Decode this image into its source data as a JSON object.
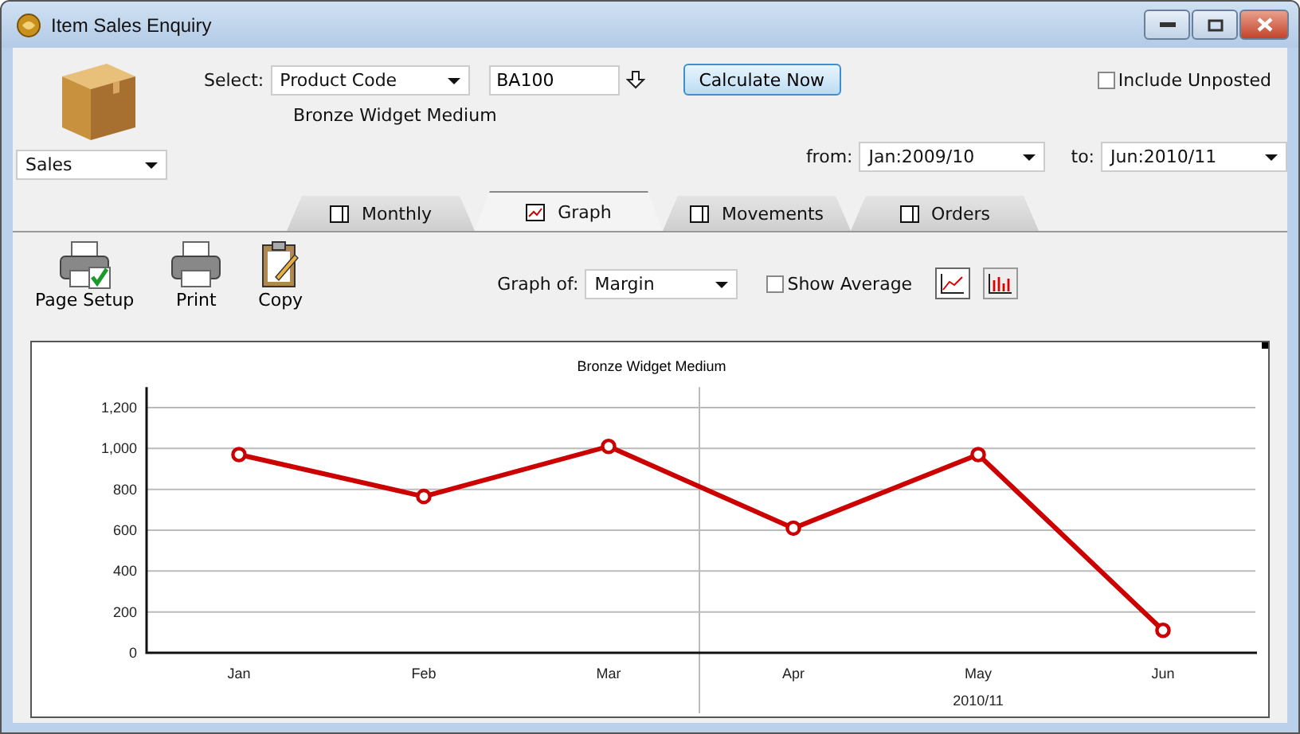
{
  "window": {
    "title": "Item Sales Enquiry"
  },
  "header": {
    "select_label": "Select:",
    "select_value": "Product Code",
    "code_value": "BA100",
    "calculate_button": "Calculate Now",
    "include_unposted": {
      "label": "Include Unposted",
      "checked": false
    },
    "product_name": "Bronze Widget Medium",
    "mode_value": "Sales",
    "from_label": "from:",
    "from_value": "Jan:2009/10",
    "to_label": "to:",
    "to_value": "Jun:2010/11"
  },
  "tabs": [
    {
      "label": "Monthly",
      "selected": false
    },
    {
      "label": "Graph",
      "selected": true
    },
    {
      "label": "Movements",
      "selected": false
    },
    {
      "label": "Orders",
      "selected": false
    }
  ],
  "toolbar": {
    "buttons": [
      {
        "label": "Page Setup",
        "kind": "setup"
      },
      {
        "label": "Print",
        "kind": "print"
      },
      {
        "label": "Copy",
        "kind": "copy"
      }
    ],
    "graph_of_label": "Graph of:",
    "graph_of_value": "Margin",
    "show_average": {
      "label": "Show Average",
      "checked": false
    },
    "chart_types": [
      {
        "kind": "line",
        "selected": true
      },
      {
        "kind": "bar",
        "selected": false
      }
    ]
  },
  "chart": {
    "chart_data": {
      "type": "line",
      "title": "Bronze Widget Medium",
      "categories": [
        "Jan",
        "Feb",
        "Mar",
        "Apr",
        "May",
        "Jun"
      ],
      "series": [
        {
          "color": "#cc0000",
          "marker": "circle",
          "values": [
            970,
            765,
            1010,
            610,
            970,
            110
          ]
        }
      ],
      "grid": true,
      "ylim": [
        0,
        1300
      ],
      "yticks": [
        {
          "value": 0,
          "label": "0"
        },
        {
          "value": 200,
          "label": "200"
        },
        {
          "value": 400,
          "label": "400"
        },
        {
          "value": 600,
          "label": "600"
        },
        {
          "value": 800,
          "label": "800"
        },
        {
          "value": 1000,
          "label": "1,000"
        },
        {
          "value": 1200,
          "label": "1,200"
        }
      ]
    },
    "period_label": "2010/11"
  }
}
